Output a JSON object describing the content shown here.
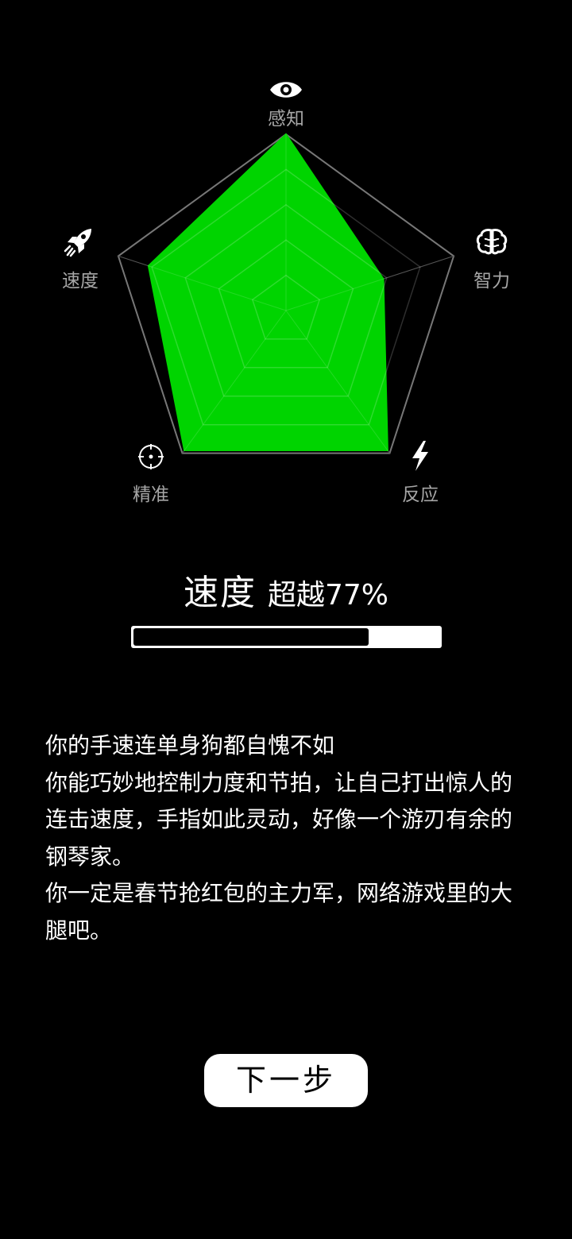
{
  "radar": {
    "labels": {
      "perception": "感知",
      "intelligence": "智力",
      "reaction": "反应",
      "precision": "精准",
      "speed": "速度"
    },
    "values": {
      "perception": 1.0,
      "intelligence": 0.58,
      "reaction": 0.98,
      "precision": 0.98,
      "speed": 0.82
    },
    "levels": 5,
    "fill_color": "#00d400",
    "outline_color": "#777777",
    "icons": {
      "perception": "eye-icon",
      "intelligence": "brain-icon",
      "reaction": "lightning-icon",
      "precision": "crosshair-icon",
      "speed": "rocket-icon"
    }
  },
  "result": {
    "attribute": "速度",
    "exceed_text": "超越77%",
    "progress": 0.77
  },
  "description": [
    "你的手速连单身狗都自愧不如",
    "你能巧妙地控制力度和节拍，让自己打出惊人的连击速度，手指如此灵动，好像一个游刃有余的钢琴家。",
    "你一定是春节抢红包的主力军，网络游戏里的大腿吧。"
  ],
  "next_button": {
    "label": "下一步"
  }
}
